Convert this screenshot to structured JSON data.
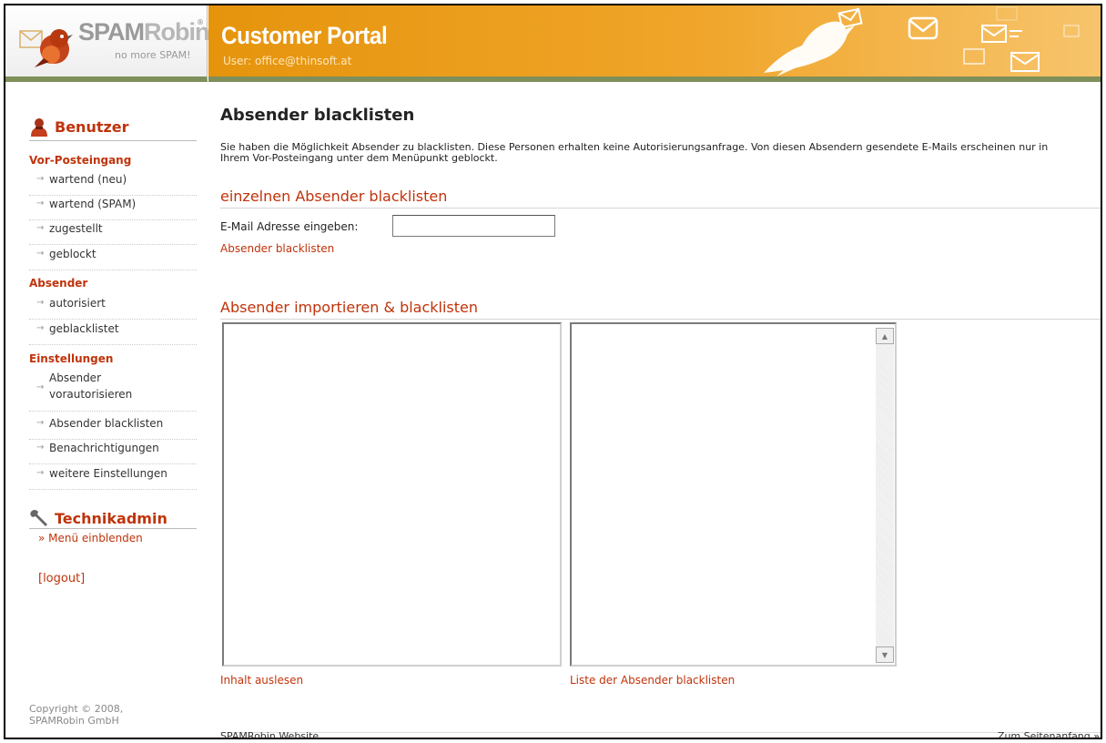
{
  "logo": {
    "brand": "SPAMRobin",
    "brand_a": "SPAM",
    "brand_b": "Robin",
    "tagline": "no more SPAM!",
    "reg": "®"
  },
  "header": {
    "title": "Customer Portal",
    "user": "User: office@thinsoft.at"
  },
  "sidebar": {
    "benutzer_title": "Benutzer",
    "groups": [
      {
        "title": "Vor-Posteingang",
        "items": [
          "wartend (neu)",
          "wartend (SPAM)",
          "zugestellt",
          "geblockt"
        ]
      },
      {
        "title": "Absender",
        "items": [
          "autorisiert",
          "geblacklistet"
        ]
      },
      {
        "title": "Einstellungen",
        "items": [
          "Absender vorautorisieren",
          "Absender blacklisten",
          "Benachrichtigungen",
          "weitere Einstellungen"
        ]
      }
    ],
    "tech_title": "Technikadmin",
    "menu_link": "» Menü einblenden",
    "logout": "[logout]",
    "copyright_1": "Copyright © 2008,",
    "copyright_2": "SPAMRobin GmbH"
  },
  "main": {
    "title": "Absender blacklisten",
    "intro": "Sie haben die Möglichkeit Absender zu blacklisten. Diese Personen erhalten keine Autorisierungsanfrage. Von diesen Absendern gesendete E-Mails erscheinen nur in Ihrem Vor-Posteingang unter dem Menüpunkt geblockt.",
    "single_heading": "einzelnen Absender blacklisten",
    "email_label": "E-Mail Adresse eingeben:",
    "email_value": "",
    "single_link": "Absender blacklisten",
    "import_heading": "Absender importieren & blacklisten",
    "left_textarea": "",
    "right_textarea": "",
    "read_link": "Inhalt auslesen",
    "blacklist_list_link": "Liste der Absender blacklisten"
  },
  "footer": {
    "left": "SPAMRobin Website",
    "right": "Zum Seitenanfang »"
  },
  "colors": {
    "accent": "#c0330a",
    "banner": "#f0a52a",
    "banner_border": "#7f8f5a"
  }
}
